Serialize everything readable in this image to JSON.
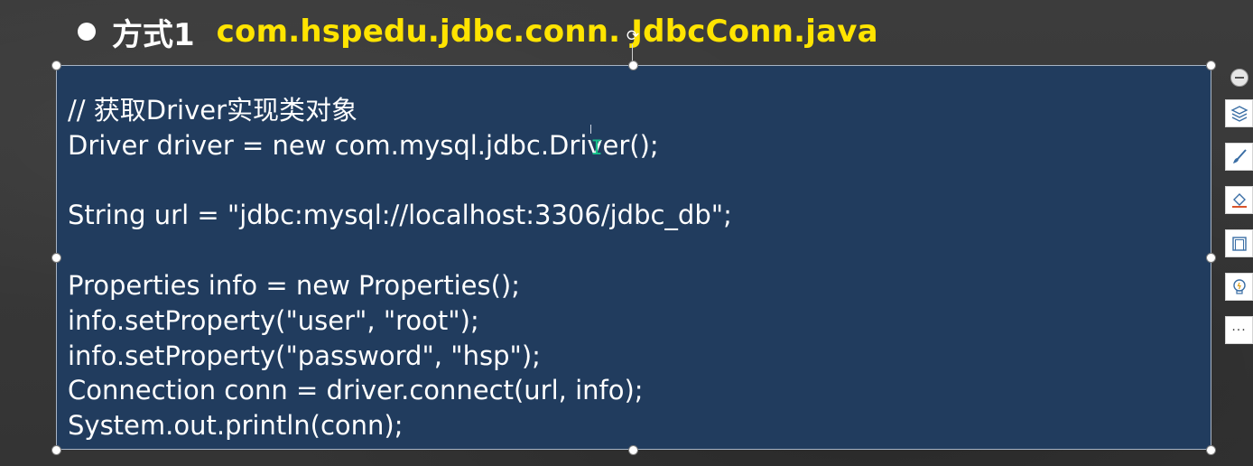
{
  "slide": {
    "title_label": "方式1",
    "title_path": "com.hspedu.jdbc.conn. JdbcConn.java",
    "colors": {
      "background": "#3a3a3a",
      "code_box": "#213c5e",
      "title_path": "#ffe400",
      "text": "#ffffff",
      "cursor": "#16c08a"
    }
  },
  "code": {
    "lines": [
      "// 获取Driver实现类对象",
      "Driver driver = new com.mysql.jdbc.Driver();",
      "",
      "String url = \"jdbc:mysql://localhost:3306/jdbc_db\";",
      "",
      "Properties info = new Properties();",
      "info.setProperty(\"user\", \"root\");",
      "info.setProperty(\"password\", \"hsp\");",
      "Connection conn = driver.connect(url, info);",
      "System.out.println(conn);"
    ]
  },
  "toolbar": {
    "items": [
      {
        "name": "collapse-icon"
      },
      {
        "name": "layers-icon"
      },
      {
        "name": "brush-icon"
      },
      {
        "name": "fill-icon"
      },
      {
        "name": "frame-icon"
      },
      {
        "name": "lightbulb-icon"
      },
      {
        "name": "more-icon"
      }
    ],
    "more_label": "···"
  },
  "cursor": {
    "glyph": "I"
  }
}
